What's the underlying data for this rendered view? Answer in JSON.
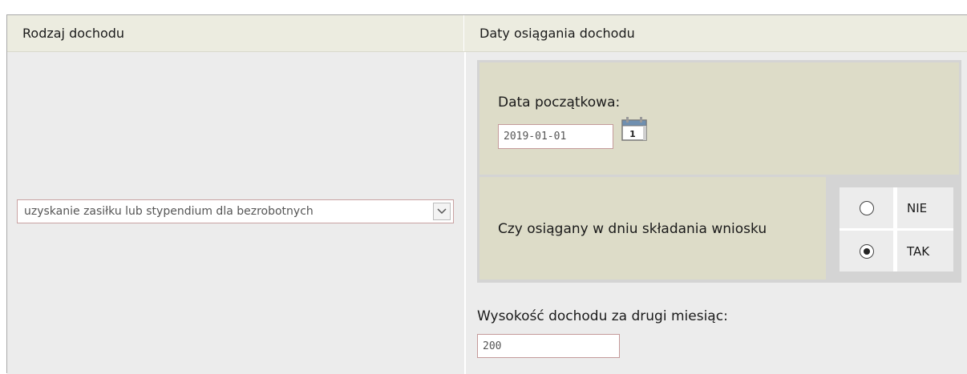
{
  "header": {
    "col_income_type": "Rodzaj dochodu",
    "col_income_dates": "Daty osiągania dochodu"
  },
  "income_type": {
    "selected": "uzyskanie zasiłku lub stypendium dla bezrobotnych"
  },
  "dates": {
    "start_label": "Data początkowa:",
    "start_value": "2019-01-01",
    "calendar_day": "1",
    "question": "Czy osiągany w dniu składania wniosku",
    "options": [
      {
        "label": "NIE",
        "selected": false
      },
      {
        "label": "TAK",
        "selected": true
      }
    ]
  },
  "second_month": {
    "label": "Wysokość dochodu za drugi miesiąc:",
    "value": "200"
  },
  "colors": {
    "header_bg": "#ecece0",
    "panel_bg": "#dddcc8",
    "input_border": "#c49a9a"
  }
}
